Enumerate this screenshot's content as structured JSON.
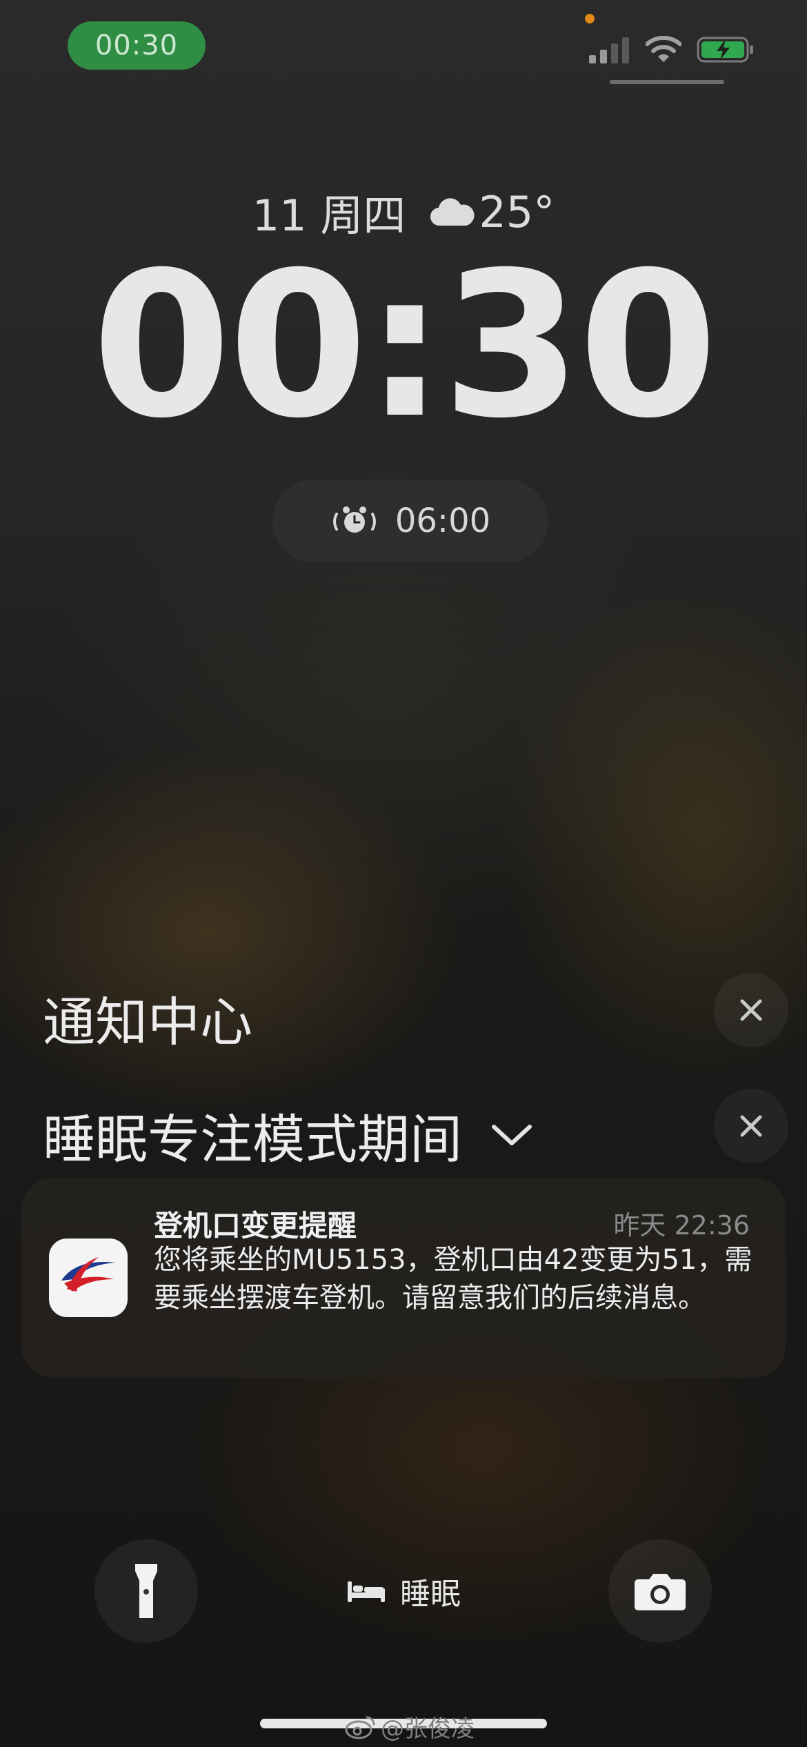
{
  "status_bar": {
    "time": "00:30",
    "icons": [
      "cellular-signal-icon",
      "wifi-icon",
      "battery-charging-icon"
    ],
    "accent_colors": {
      "time_pill": "#2f8d44",
      "privacy_dot": "#e58a16",
      "battery": "#2fa84f"
    }
  },
  "lock_screen": {
    "date": "11 周四",
    "weather_icon": "cloud-icon",
    "temperature": "25°",
    "clock": "00:30",
    "alarm_icon": "alarm-clock-icon",
    "alarm_time": "06:00"
  },
  "notification_center": {
    "title": "通知中心",
    "focus_group_title": "睡眠专注模式期间",
    "notification": {
      "app_icon": "china-eastern-logo-icon",
      "title": "登机口变更提醒",
      "time": "昨天 22:36",
      "body": "您将乘坐的MU5153，登机口由42变更为51，需要乘坐摆渡车登机。请留意我们的后续消息。"
    }
  },
  "bottom_bar": {
    "left_button_icon": "flashlight-icon",
    "focus_icon": "bed-icon",
    "focus_label": "睡眠",
    "right_button_icon": "camera-icon"
  },
  "watermark": {
    "icon": "weibo-icon",
    "text": "@张俊凌"
  }
}
